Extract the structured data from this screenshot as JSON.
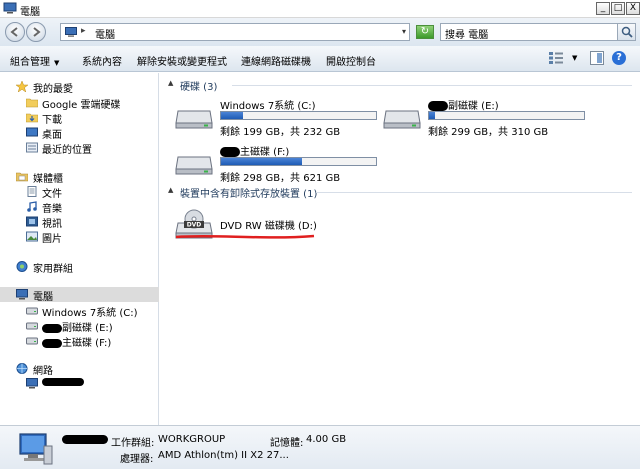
{
  "window": {
    "title": "電腦"
  },
  "titlebar_buttons": {
    "minimize": "_",
    "maximize": "□",
    "close": "X"
  },
  "address": {
    "separator": "▸",
    "location": "電腦",
    "dropdown": "▾",
    "refresh": "↻"
  },
  "search": {
    "placeholder": "搜尋 電腦"
  },
  "toolbar": {
    "organize": "組合管理",
    "properties": "系統內容",
    "uninstall": "解除安裝或變更程式",
    "map_drive": "連線網路磁碟機",
    "control_panel": "開啟控制台",
    "help": "?"
  },
  "nav": {
    "favorites": "我的最愛",
    "favorites_items": [
      "Google 雲端硬碟",
      "下載",
      "桌面",
      "最近的位置"
    ],
    "libraries": "媒體櫃",
    "libraries_items": [
      "文件",
      "音樂",
      "視訊",
      "圖片"
    ],
    "homegroup": "家用群組",
    "computer": "電腦",
    "computer_items": [
      "Windows 7系統 (C:)",
      "副磁碟 (E:)",
      "主磁碟 (F:)"
    ],
    "network": "網路"
  },
  "content": {
    "hard_disks_header": "硬碟 (3)",
    "removable_header": "裝置中含有卸除式存放裝置 (1)",
    "drives": [
      {
        "name": "Windows 7系統 (C:)",
        "free": "剩餘 199 GB，共 232 GB",
        "used_fraction": 0.14
      },
      {
        "name": "副磁碟 (E:)",
        "free": "剩餘 299 GB，共 310 GB",
        "used_fraction": 0.04
      },
      {
        "name": "主磁碟 (F:)",
        "free": "剩餘 298 GB，共 621 GB",
        "used_fraction": 0.52
      }
    ],
    "dvd": {
      "name": "DVD RW 磁碟機 (D:)",
      "icon_text": "DVD"
    }
  },
  "details": {
    "workgroup_label": "工作群組:",
    "workgroup_value": "WORKGROUP",
    "memory_label": "記憶體:",
    "memory_value": "4.00 GB",
    "processor_label": "處理器:",
    "processor_value": "AMD Athlon(tm) II X2 27..."
  },
  "colors": {
    "bar_fill": "#1e5bb5",
    "accent": "#2a6fd6"
  }
}
